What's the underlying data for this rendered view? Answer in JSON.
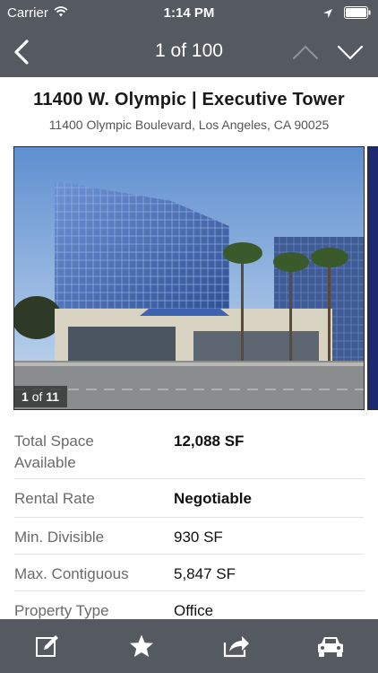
{
  "status_bar": {
    "carrier": "Carrier",
    "time": "1:14 PM"
  },
  "nav": {
    "pager": "1 of 100",
    "icons": [
      "chevron-left-icon",
      "chevron-up-icon",
      "chevron-down-icon"
    ]
  },
  "listing": {
    "title": "11400 W. Olympic | Executive Tower",
    "address": "11400 Olympic Boulevard, Los Angeles, CA 90025"
  },
  "gallery": {
    "current": "1",
    "of_text": "of",
    "total": "11"
  },
  "details": [
    {
      "label": "Total Space\nAvailable",
      "value": "12,088 SF",
      "bold": true
    },
    {
      "label": "Rental Rate",
      "value": "Negotiable",
      "bold": true
    },
    {
      "label": "Min. Divisible",
      "value": "930 SF",
      "bold": false
    },
    {
      "label": "Max. Contiguous",
      "value": "5,847 SF",
      "bold": false
    },
    {
      "label": "Property Type",
      "value": "Office",
      "bold": false
    }
  ],
  "tab_bar": {
    "icons": [
      "edit-note-icon",
      "star-icon",
      "share-icon",
      "car-icon"
    ]
  },
  "colors": {
    "bar_background": "#555a60",
    "sky": "#a9c8ea",
    "building_glass": "#4f79c2"
  }
}
